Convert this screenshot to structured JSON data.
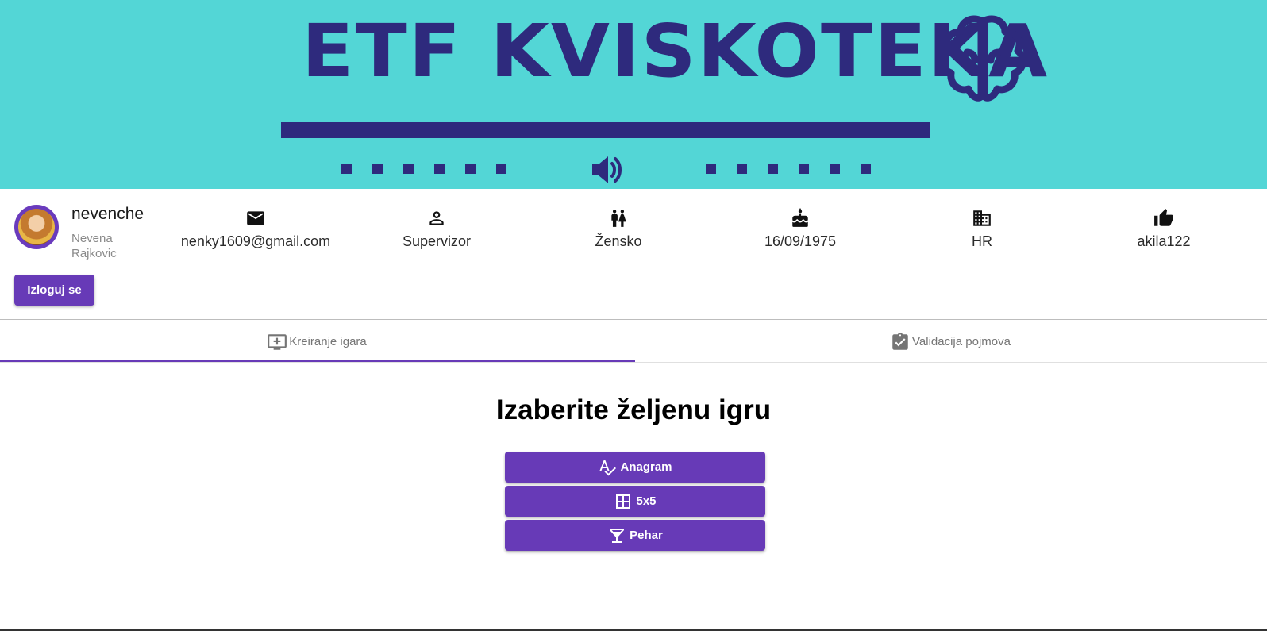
{
  "banner": {
    "title": "ETF KVISKOTEKA",
    "icons": [
      "brain-icon",
      "speaker-icon"
    ],
    "colors": {
      "background": "#53d6d6",
      "foreground": "#2e2a7d"
    }
  },
  "profile": {
    "username": "nevenche",
    "first_name": "Nevena",
    "last_name": "Rajkovic",
    "email": "nenky1609@gmail.com",
    "role": "Supervizor",
    "gender": "Žensko",
    "birthdate": "16/09/1975",
    "department": "HR",
    "reference": "akila122",
    "logout_label": "Izloguj se",
    "icons": [
      "mail-icon",
      "person-icon",
      "wc-icon",
      "cake-icon",
      "building-icon",
      "thumbs-up-icon"
    ]
  },
  "tabs": [
    {
      "label": "Kreiranje igara",
      "icon": "add-to-queue-icon",
      "active": true
    },
    {
      "label": "Validacija pojmova",
      "icon": "assignment-check-icon",
      "active": false
    }
  ],
  "main": {
    "title": "Izaberite željenu igru",
    "games": [
      {
        "label": "Anagram",
        "icon": "spellcheck-icon"
      },
      {
        "label": "5x5",
        "icon": "grid-icon"
      },
      {
        "label": "Pehar",
        "icon": "cup-icon"
      }
    ]
  },
  "accent_color": "#673ab7"
}
